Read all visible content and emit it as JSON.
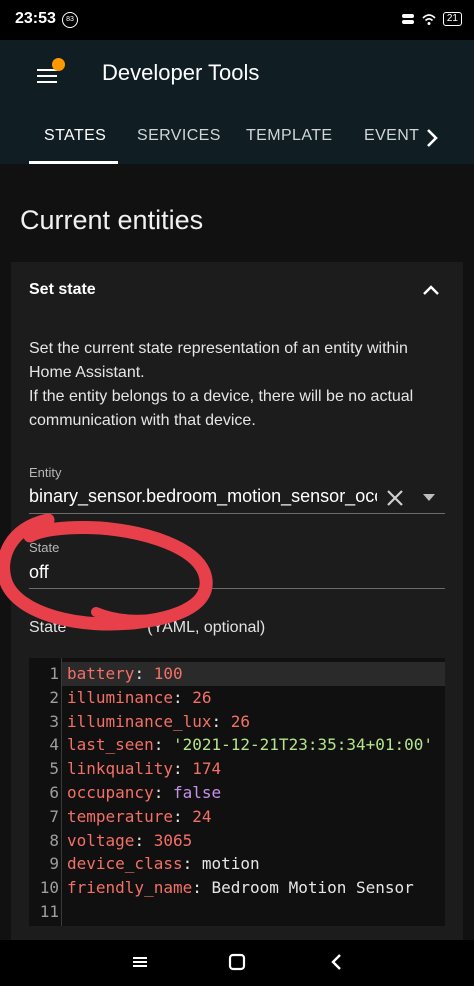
{
  "status_bar": {
    "time": "23:53",
    "notification_badge": "83",
    "battery": "21",
    "icons": [
      "toggle-icon",
      "wifi-icon",
      "battery-icon"
    ]
  },
  "app_bar": {
    "title": "Developer Tools",
    "menu_icon": "menu-icon",
    "notification_dot_color": "#ff9800"
  },
  "tabs": {
    "items": [
      "STATES",
      "SERVICES",
      "TEMPLATE",
      "EVENT"
    ],
    "active": "STATES",
    "more_icon": "chevron-right-icon"
  },
  "page": {
    "heading": "Current entities"
  },
  "set_state": {
    "title": "Set state",
    "description_1": "Set the current state representation of an entity within Home Assistant.",
    "description_2": "If the entity belongs to a device, there will be no actual communication with that device.",
    "entity": {
      "label": "Entity",
      "value": "binary_sensor.bedroom_motion_sensor_occupancy"
    },
    "state": {
      "label": "State",
      "value": "off"
    },
    "attributes_label_start": "State",
    "attributes_label_end": "(YAML, optional)",
    "attributes": [
      {
        "key": "battery",
        "value": "100",
        "type": "number"
      },
      {
        "key": "illuminance",
        "value": "26",
        "type": "number"
      },
      {
        "key": "illuminance_lux",
        "value": "26",
        "type": "number"
      },
      {
        "key": "last_seen",
        "value": "'2021-12-21T23:35:34+01:00'",
        "type": "string"
      },
      {
        "key": "linkquality",
        "value": "174",
        "type": "number"
      },
      {
        "key": "occupancy",
        "value": "false",
        "type": "bool"
      },
      {
        "key": "temperature",
        "value": "24",
        "type": "number"
      },
      {
        "key": "voltage",
        "value": "3065",
        "type": "number"
      },
      {
        "key": "device_class",
        "value": "motion",
        "type": "plain"
      },
      {
        "key": "friendly_name",
        "value": "Bedroom Motion Sensor",
        "type": "plain"
      }
    ],
    "line_numbers": [
      "1",
      "2",
      "3",
      "4",
      "5",
      "6",
      "7",
      "8",
      "9",
      "10",
      "11"
    ]
  },
  "nav_bar": {
    "icons": [
      "recents-icon",
      "home-icon",
      "back-icon"
    ]
  },
  "colors": {
    "header_bg": "#101e24",
    "card_bg": "#1c1c1c",
    "annotation": "#e8404a"
  }
}
